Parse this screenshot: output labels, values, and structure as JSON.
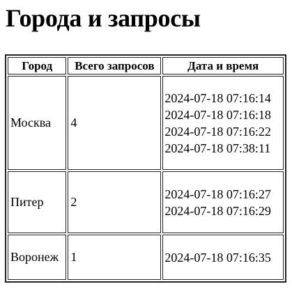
{
  "page": {
    "title": "Города и запросы"
  },
  "table": {
    "columns": [
      "Город",
      "Всего запросов",
      "Дата и время"
    ],
    "rows": [
      {
        "city": "Москва",
        "total": "4",
        "datetimes": [
          "2024-07-18 07:16:14",
          "2024-07-18 07:16:18",
          "2024-07-18 07:16:22",
          "2024-07-18 07:38:11"
        ]
      },
      {
        "city": "Питер",
        "total": "2",
        "datetimes": [
          "2024-07-18 07:16:27",
          "2024-07-18 07:16:29"
        ]
      },
      {
        "city": "Воронеж",
        "total": "1",
        "datetimes": [
          "2024-07-18 07:16:35"
        ]
      }
    ]
  }
}
